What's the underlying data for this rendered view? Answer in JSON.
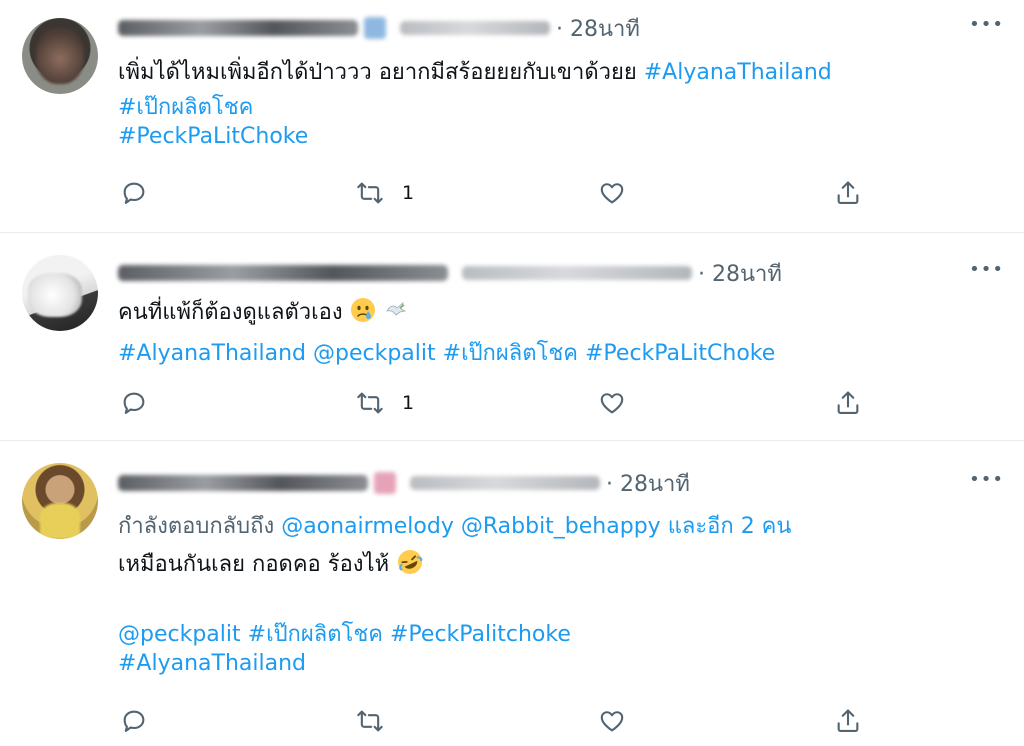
{
  "tweets": [
    {
      "time": "28นาที",
      "more_label": "•••",
      "lines": [
        [
          {
            "text": "เพิ่มได้ไหมเพิ่มอีกได้ป่าววว อยากมีสร้อยยยกับเขาด้วยย ",
            "style": "text"
          },
          {
            "text": "#AlyanaThailand",
            "style": "link"
          }
        ],
        [
          {
            "text": "#เป๊กผลิตโชค",
            "style": "link"
          }
        ],
        [
          {
            "text": "#PeckPaLitChoke",
            "style": "link"
          }
        ]
      ],
      "retweet_count": "1"
    },
    {
      "time": "28นาที",
      "more_label": "•••",
      "lines": [
        [
          {
            "text": "คนที่แพ้ก็ต้องดูแลตัวเอง",
            "style": "text"
          }
        ],
        [
          {
            "text": "#AlyanaThailand",
            "style": "link"
          },
          {
            "text": " @peckpalit",
            "style": "link"
          },
          {
            "text": " #เป๊กผลิตโชค",
            "style": "link"
          },
          {
            "text": " #PeckPaLitChoke",
            "style": "link"
          }
        ]
      ],
      "retweet_count": "1"
    },
    {
      "time": "28นาที",
      "more_label": "•••",
      "reply_prefix": "กำลังตอบกลับถึง ",
      "reply_to_1": "@aonairmelody",
      "reply_to_2": "@Rabbit_behappy",
      "reply_more": "และอีก 2 คน",
      "lines": [
        [
          {
            "text": "เหมือนกันเลย กอดคอ ร้องไห้ ",
            "style": "text"
          }
        ],
        [
          {
            "text": "@peckpalit",
            "style": "link"
          },
          {
            "text": " #เป๊กผลิตโชค",
            "style": "link"
          },
          {
            "text": " #PeckPalitchoke",
            "style": "link"
          }
        ],
        [
          {
            "text": "#AlyanaThailand",
            "style": "link"
          }
        ]
      ],
      "retweet_count": ""
    }
  ],
  "icons": {
    "reply": "reply-icon",
    "retweet": "retweet-icon",
    "like": "heart-icon",
    "share": "share-icon",
    "more": "more-icon"
  },
  "colors": {
    "link": "#1d9bf0",
    "muted": "#536471",
    "text": "#0f1419",
    "divider": "#e6ecf0"
  }
}
